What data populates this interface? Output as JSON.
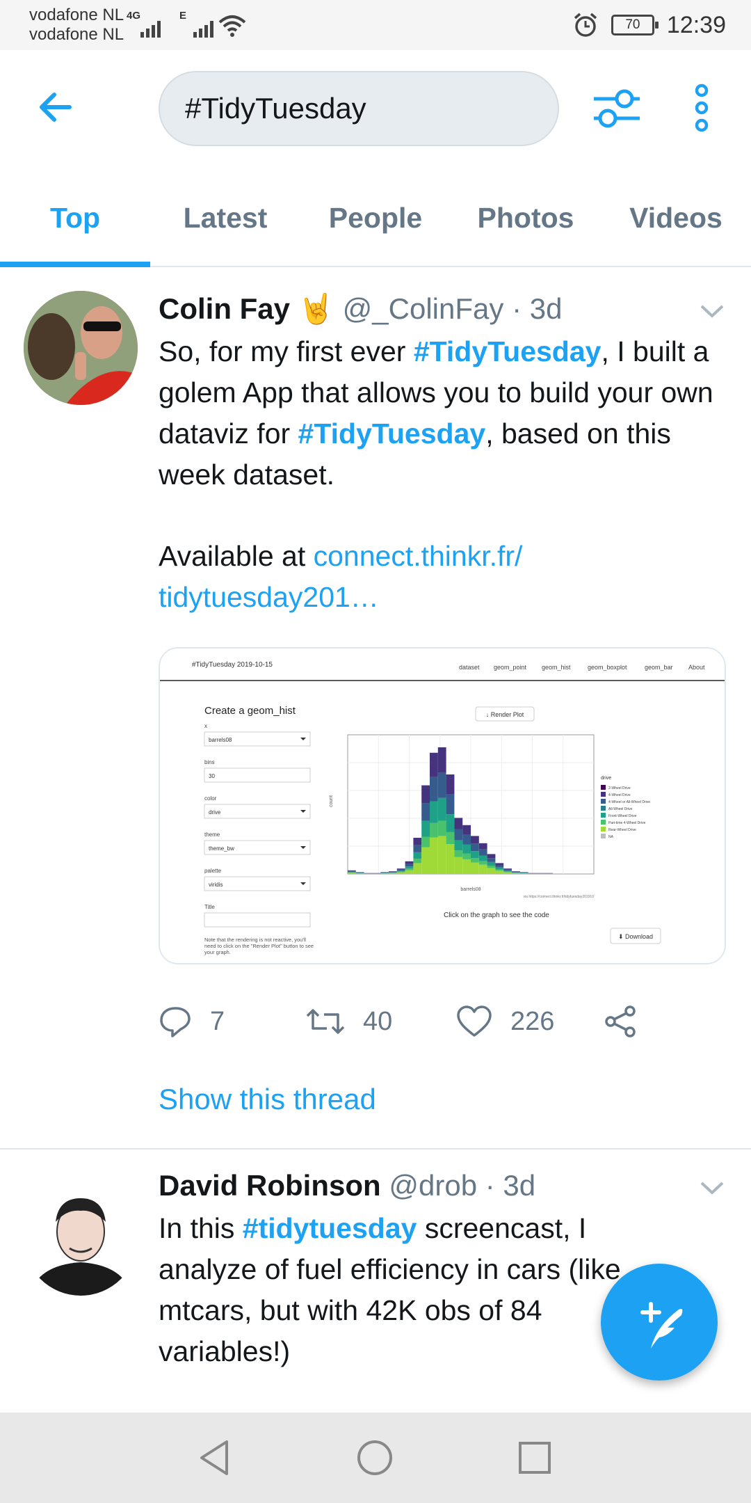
{
  "status_bar": {
    "carrier_1": "vodafone NL",
    "carrier_2": "vodafone NL",
    "network_1": "4G",
    "network_2": "E",
    "battery": "70",
    "time": "12:39"
  },
  "header": {
    "search_value": "#TidyTuesday"
  },
  "tabs": [
    {
      "label": "Top",
      "active": true
    },
    {
      "label": "Latest",
      "active": false
    },
    {
      "label": "People",
      "active": false
    },
    {
      "label": "Photos",
      "active": false
    },
    {
      "label": "Videos",
      "active": false
    }
  ],
  "tweet1": {
    "name": "Colin Fay",
    "emoji": "🤘",
    "handle": "@_ColinFay",
    "time": "3d",
    "text_1": "So, for my first ever ",
    "tag_1": "#TidyTuesday",
    "text_2": ", I built a golem App that allows you to build your own dataviz for ",
    "tag_2": "#TidyTuesday",
    "text_3": ", based on this week dataset.",
    "text_4": "Available at ",
    "link_1": "connect.thinkr.fr/",
    "link_2": "tidytuesday201…",
    "card": {
      "app_title": "#TidyTuesday 2019-10-15",
      "nav": [
        "dataset",
        "geom_point",
        "geom_hist",
        "geom_boxplot",
        "geom_bar",
        "About"
      ],
      "panel_title": "Create a geom_hist",
      "fields": [
        {
          "label": "x",
          "value": "barrels08",
          "kind": "select"
        },
        {
          "label": "bins",
          "value": "30",
          "kind": "input"
        },
        {
          "label": "color",
          "value": "drive",
          "kind": "select"
        },
        {
          "label": "theme",
          "value": "theme_bw",
          "kind": "select"
        },
        {
          "label": "palette",
          "value": "viridis",
          "kind": "select"
        },
        {
          "label": "Title",
          "value": "",
          "kind": "input"
        }
      ],
      "note": "Note that the rendering is not reactive, you'll need to click on the \"Render Plot\" button to see your graph.",
      "render_button": "Render Plot",
      "click_hint": "Click on the graph to see the code",
      "download_button": "Download",
      "plot_xlabel": "barrels08",
      "plot_ylabel": "count",
      "plot_caption": "via https://connect.thinkr.fr/tidytuesday201910",
      "legend_title": "drive",
      "legend_items": [
        "2-Wheel Drive",
        "4-Wheel Drive",
        "4-Wheel or All-Wheel Drive",
        "All-Wheel Drive",
        "Front-Wheel Drive",
        "Part-time 4-Wheel Drive",
        "Rear-Wheel Drive",
        "NA"
      ],
      "legend_colors": [
        "#440154",
        "#46337e",
        "#365c8d",
        "#277f8e",
        "#1fa187",
        "#4ac16d",
        "#a0da39",
        "#bdbdbd"
      ]
    },
    "replies": "7",
    "retweets": "40",
    "likes": "226",
    "show_thread": "Show this thread"
  },
  "tweet2": {
    "name": "David Robinson",
    "handle": "@drob",
    "time": "3d",
    "text_1": "In this ",
    "tag_1": "#tidytuesday",
    "text_2": " screencast, I analyze of fuel efficiency in cars (like mtcars, but with 42K obs of 84 variables!)"
  },
  "icons": {
    "back": "arrow-left-icon",
    "filter": "sliders-icon",
    "more": "kebab-menu-icon",
    "compose": "compose-feather-icon"
  }
}
